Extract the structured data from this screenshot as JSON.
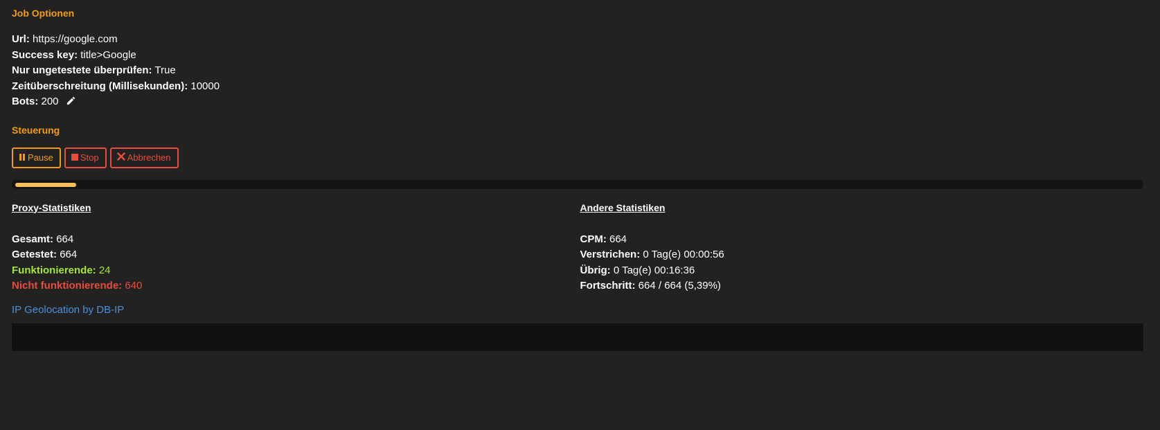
{
  "job": {
    "title": "Job Optionen",
    "options": [
      {
        "label": "Url:",
        "value": "https://google.com"
      },
      {
        "label": "Success key:",
        "value": "title>Google"
      },
      {
        "label": "Nur ungetestete überprüfen:",
        "value": "True"
      },
      {
        "label": "Zeitüberschreitung (Millisekunden):",
        "value": "10000"
      },
      {
        "label": "Bots:",
        "value": "200"
      }
    ]
  },
  "control": {
    "title": "Steuerung",
    "pause_label": "Pause",
    "stop_label": "Stop",
    "abort_label": "Abbrechen"
  },
  "progress": {
    "fraction": 0.0539
  },
  "proxy_stats": {
    "title": "Proxy-Statistiken",
    "total_label": "Gesamt:",
    "total_value": "664",
    "tested_label": "Getestet:",
    "tested_value": "664",
    "working_label": "Funktionierende:",
    "working_value": "24",
    "not_working_label": "Nicht funktionierende:",
    "not_working_value": "640"
  },
  "other_stats": {
    "title": "Andere Statistiken",
    "cpm_label": "CPM:",
    "cpm_value": "664",
    "elapsed_label": "Verstrichen:",
    "elapsed_value": "0 Tag(e) 00:00:56",
    "remaining_label": "Übrig:",
    "remaining_value": "0 Tag(e) 00:16:36",
    "progress_label": "Fortschritt:",
    "progress_value": "664 / 664 (5,39%)"
  },
  "geo_link": "IP Geolocation by DB-IP",
  "colors": {
    "accent": "#f39c12",
    "danger": "#e74c3c",
    "success": "#a3e635",
    "link": "#4a90d9",
    "progress": "#f7c15a"
  },
  "icons": {
    "edit": "pencil-icon",
    "pause": "pause-icon",
    "stop": "stop-icon",
    "abort": "x-icon"
  }
}
